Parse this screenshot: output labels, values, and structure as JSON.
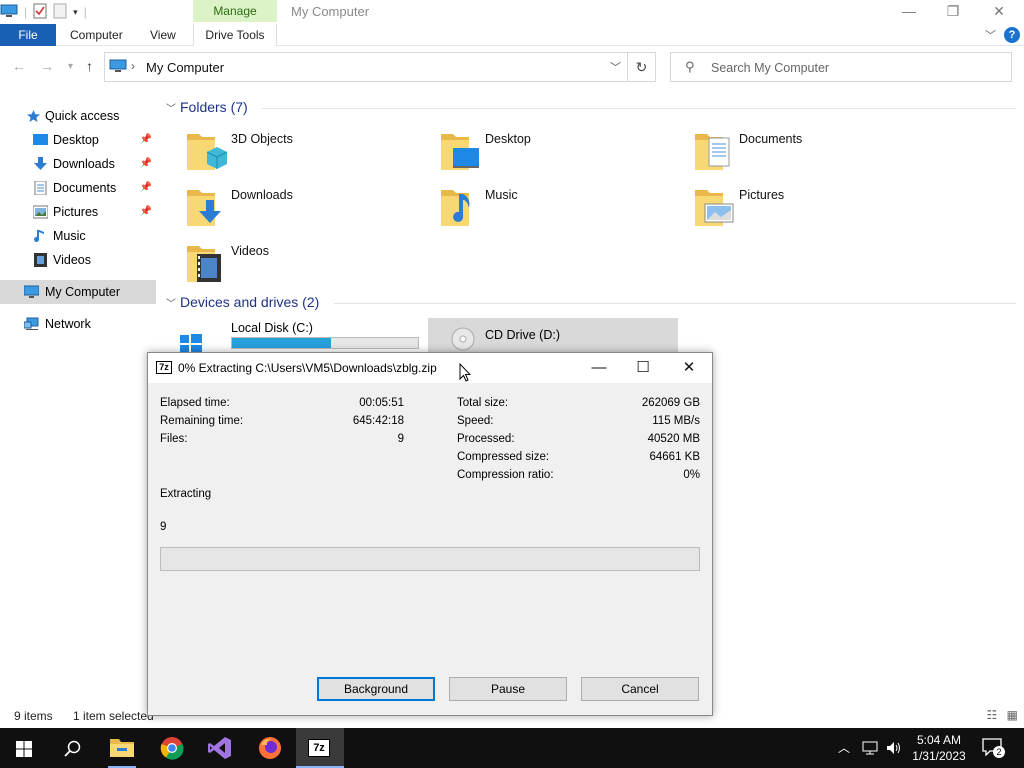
{
  "explorer": {
    "title": "My Computer",
    "context_tab": "Manage",
    "tabs": [
      "File",
      "Computer",
      "View",
      "Drive Tools"
    ],
    "address_path": "My Computer",
    "search_placeholder": "Search My Computer",
    "sidebar": [
      {
        "label": "Quick access",
        "icon": "star-icon",
        "pinned": false
      },
      {
        "label": "Desktop",
        "icon": "desktop-icon",
        "pinned": true
      },
      {
        "label": "Downloads",
        "icon": "download-icon",
        "pinned": true
      },
      {
        "label": "Documents",
        "icon": "document-icon",
        "pinned": true
      },
      {
        "label": "Pictures",
        "icon": "picture-icon",
        "pinned": true
      },
      {
        "label": "Music",
        "icon": "music-icon",
        "pinned": false
      },
      {
        "label": "Videos",
        "icon": "video-icon",
        "pinned": false
      },
      {
        "label": "My Computer",
        "icon": "computer-icon",
        "pinned": false,
        "selected": true
      },
      {
        "label": "Network",
        "icon": "network-icon",
        "pinned": false
      }
    ],
    "folders_header": "Folders (7)",
    "folders": [
      "3D Objects",
      "Desktop",
      "Documents",
      "Downloads",
      "Music",
      "Pictures",
      "Videos"
    ],
    "drives_header": "Devices and drives (2)",
    "drives": [
      {
        "label": "Local Disk (C:)",
        "used_fraction": 0.53
      },
      {
        "label": "CD Drive (D:)"
      }
    ],
    "status_items": "9 items",
    "status_selected": "1 item selected"
  },
  "dialog": {
    "title": "0% Extracting C:\\Users\\VM5\\Downloads\\zblg.zip",
    "left_stats": [
      {
        "label": "Elapsed time:",
        "value": "00:05:51"
      },
      {
        "label": "Remaining time:",
        "value": "645:42:18"
      },
      {
        "label": "Files:",
        "value": "9"
      }
    ],
    "right_stats": [
      {
        "label": "Total size:",
        "value": "262069 GB"
      },
      {
        "label": "Speed:",
        "value": "115 MB/s"
      },
      {
        "label": "Processed:",
        "value": "40520 MB"
      },
      {
        "label": "Compressed size:",
        "value": "64661 KB"
      },
      {
        "label": "Compression ratio:",
        "value": "0%"
      }
    ],
    "status_label": "Extracting",
    "current_item": "9",
    "progress_fraction": 0.0,
    "buttons": {
      "background": "Background",
      "pause": "Pause",
      "cancel": "Cancel"
    }
  },
  "taskbar": {
    "time": "5:04 AM",
    "date": "1/31/2023",
    "notification_count": "2",
    "apps": [
      "start-icon",
      "search-icon",
      "file-explorer-icon",
      "chrome-icon",
      "visual-studio-icon",
      "firefox-icon",
      "7zip-icon"
    ]
  },
  "colors": {
    "accent": "#195fb3",
    "manage_tab": "#dcf3c7",
    "drive_bar": "#26a0da",
    "taskbar": "#101010"
  }
}
